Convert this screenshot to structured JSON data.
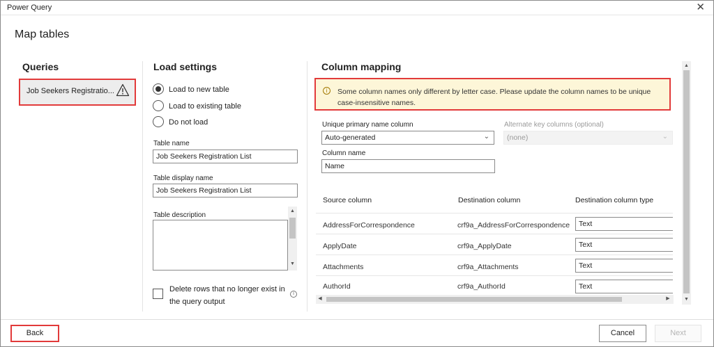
{
  "window": {
    "title": "Power Query",
    "close_glyph": "✕"
  },
  "page_title": "Map tables",
  "queries": {
    "heading": "Queries",
    "items": [
      {
        "label": "Job Seekers Registratio...",
        "icon": "warning-icon"
      }
    ]
  },
  "load_settings": {
    "heading": "Load settings",
    "options": [
      {
        "label": "Load to new table",
        "selected": true
      },
      {
        "label": "Load to existing table",
        "selected": false
      },
      {
        "label": "Do not load",
        "selected": false
      }
    ],
    "table_name_label": "Table name",
    "table_name_value": "Job Seekers Registration List",
    "display_name_label": "Table display name",
    "display_name_value": "Job Seekers Registration List",
    "description_label": "Table description",
    "description_value": "",
    "delete_rows_label_1": "Delete rows that no longer exist in",
    "delete_rows_label_2": "the query output",
    "delete_rows_checked": false
  },
  "column_mapping": {
    "heading": "Column mapping",
    "warning": "Some column names only different by letter case. Please update the column names to be unique case-insensitive names.",
    "primary_label": "Unique primary name column",
    "primary_value": "Auto-generated",
    "alternate_label": "Alternate key columns (optional)",
    "alternate_value": "(none)",
    "column_name_label": "Column name",
    "column_name_value": "Name",
    "headers": {
      "source": "Source column",
      "destination": "Destination column",
      "type": "Destination column type"
    },
    "rows": [
      {
        "source": "AddressForCorrespondence",
        "destination": "crf9a_AddressForCorrespondence",
        "type": "Text"
      },
      {
        "source": "ApplyDate",
        "destination": "crf9a_ApplyDate",
        "type": "Text"
      },
      {
        "source": "Attachments",
        "destination": "crf9a_Attachments",
        "type": "Text"
      },
      {
        "source": "AuthorId",
        "destination": "crf9a_AuthorId",
        "type": "Text"
      }
    ]
  },
  "footer": {
    "back": "Back",
    "cancel": "Cancel",
    "next": "Next"
  },
  "colors": {
    "highlight": "#e23a3a",
    "warning_bg": "#fdf6d8"
  }
}
